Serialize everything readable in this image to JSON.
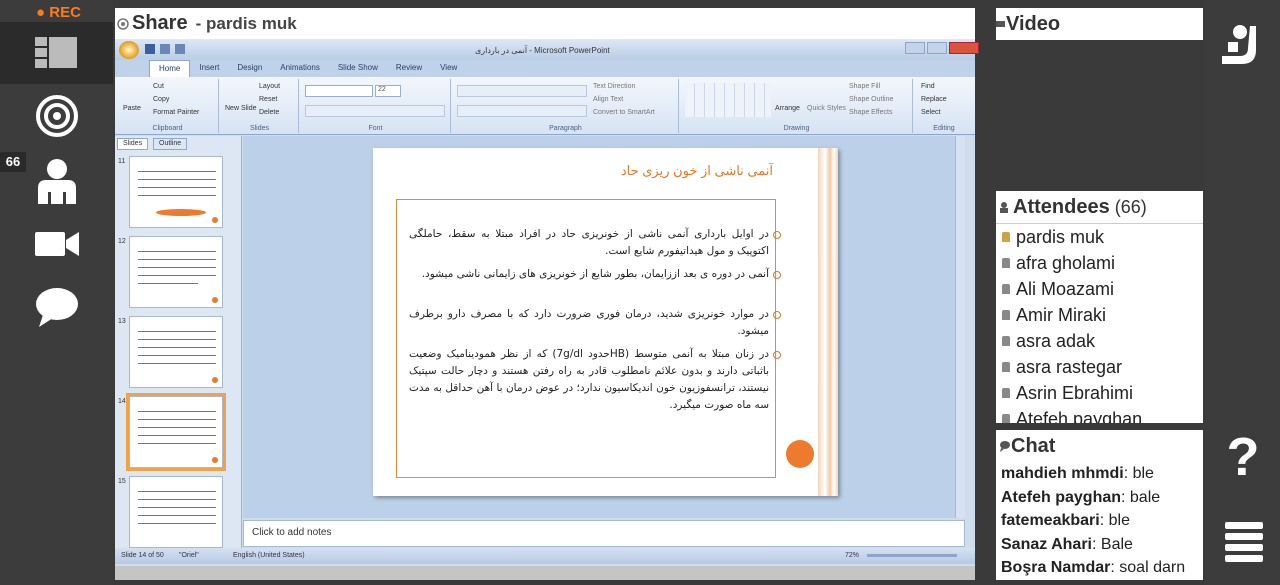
{
  "recording": {
    "label": "REC"
  },
  "rail": {
    "participants_badge": "66"
  },
  "share": {
    "title": "Share",
    "presenter": "- pardis muk"
  },
  "powerpoint": {
    "window_title": "آنمی در بارداری - Microsoft PowerPoint",
    "tabs": [
      "Home",
      "Insert",
      "Design",
      "Animations",
      "Slide Show",
      "Review",
      "View"
    ],
    "groups": {
      "clipboard": {
        "label": "Clipboard",
        "items": [
          "Paste",
          "Cut",
          "Copy",
          "Format Painter"
        ]
      },
      "slides": {
        "label": "Slides",
        "items": [
          "New Slide",
          "Layout",
          "Reset",
          "Delete"
        ]
      },
      "font": {
        "label": "Font",
        "size": "22"
      },
      "paragraph": {
        "label": "Paragraph",
        "items": [
          "Text Direction",
          "Align Text",
          "Convert to SmartArt"
        ]
      },
      "drawing": {
        "label": "Drawing",
        "items": [
          "Arrange",
          "Quick Styles",
          "Shape Fill",
          "Shape Outline",
          "Shape Effects"
        ]
      },
      "editing": {
        "label": "Editing",
        "items": [
          "Find",
          "Replace",
          "Select"
        ]
      }
    },
    "pane_tabs": [
      "Slides",
      "Outline"
    ],
    "thumbnails": [
      "11",
      "12",
      "13",
      "14",
      "15"
    ],
    "slide": {
      "title": "آنمی ناشی از خون ریزی حاد",
      "bullets": [
        "در اوایل بارداری آنمی ناشی از خونریزی حاد در افراد مبتلا به سقط، حاملگی اکتوپیک و مول هیداتیفورم شایع است.",
        "آنمی در دوره ی بعد اززایمان، بطور شایع از خونریزی های زایمانی ناشی میشود.",
        "در موارد خونریزی شدید، درمان فوری ضرورت دارد که با مصرف دارو برطرف میشود.",
        "در زنان مبتلا به آنمی متوسط (HBحدود 7g/dl) که از نظر همودینامیک وضعیت باثباتی دارند و بدون علائم نامطلوب قادر به راه رفتن هستند و دچار حالت سپتیک نیستند، ترانسفوزیون خون اندیکاسیون ندارد؛ در عوض درمان با آهن حداقل به مدت سه ماه صورت میگیرد."
      ]
    },
    "notes_placeholder": "Click to add notes",
    "status": {
      "slide_info": "Slide 14 of 50",
      "theme": "\"Oriel\"",
      "language": "English (United States)",
      "zoom": "72%"
    }
  },
  "video": {
    "title": "Video"
  },
  "attendees": {
    "title": "Attendees",
    "count": "(66)",
    "list": [
      "pardis muk",
      "afra gholami",
      "Ali Moazami",
      "Amir Miraki",
      "asra adak",
      "asra rastegar",
      "Asrin Ebrahimi",
      "Atefeh payghan"
    ]
  },
  "chat": {
    "title": "Chat",
    "messages": [
      {
        "sender": "mahdieh mhmdi",
        "text": ": ble"
      },
      {
        "sender": "Atefeh payghan",
        "text": ": bale"
      },
      {
        "sender": "fatemeakbari",
        "text": ": ble"
      },
      {
        "sender": "Sanaz Ahari",
        "text": ": Bale"
      },
      {
        "sender": "Boşra Namdar",
        "text": ": soal darn"
      }
    ]
  },
  "right_rail": {
    "help": "?"
  },
  "colors": {
    "rec": "#ff7a1a",
    "accent_orange": "#ee7a2e",
    "ppt_blue": "#bfd2ea"
  }
}
